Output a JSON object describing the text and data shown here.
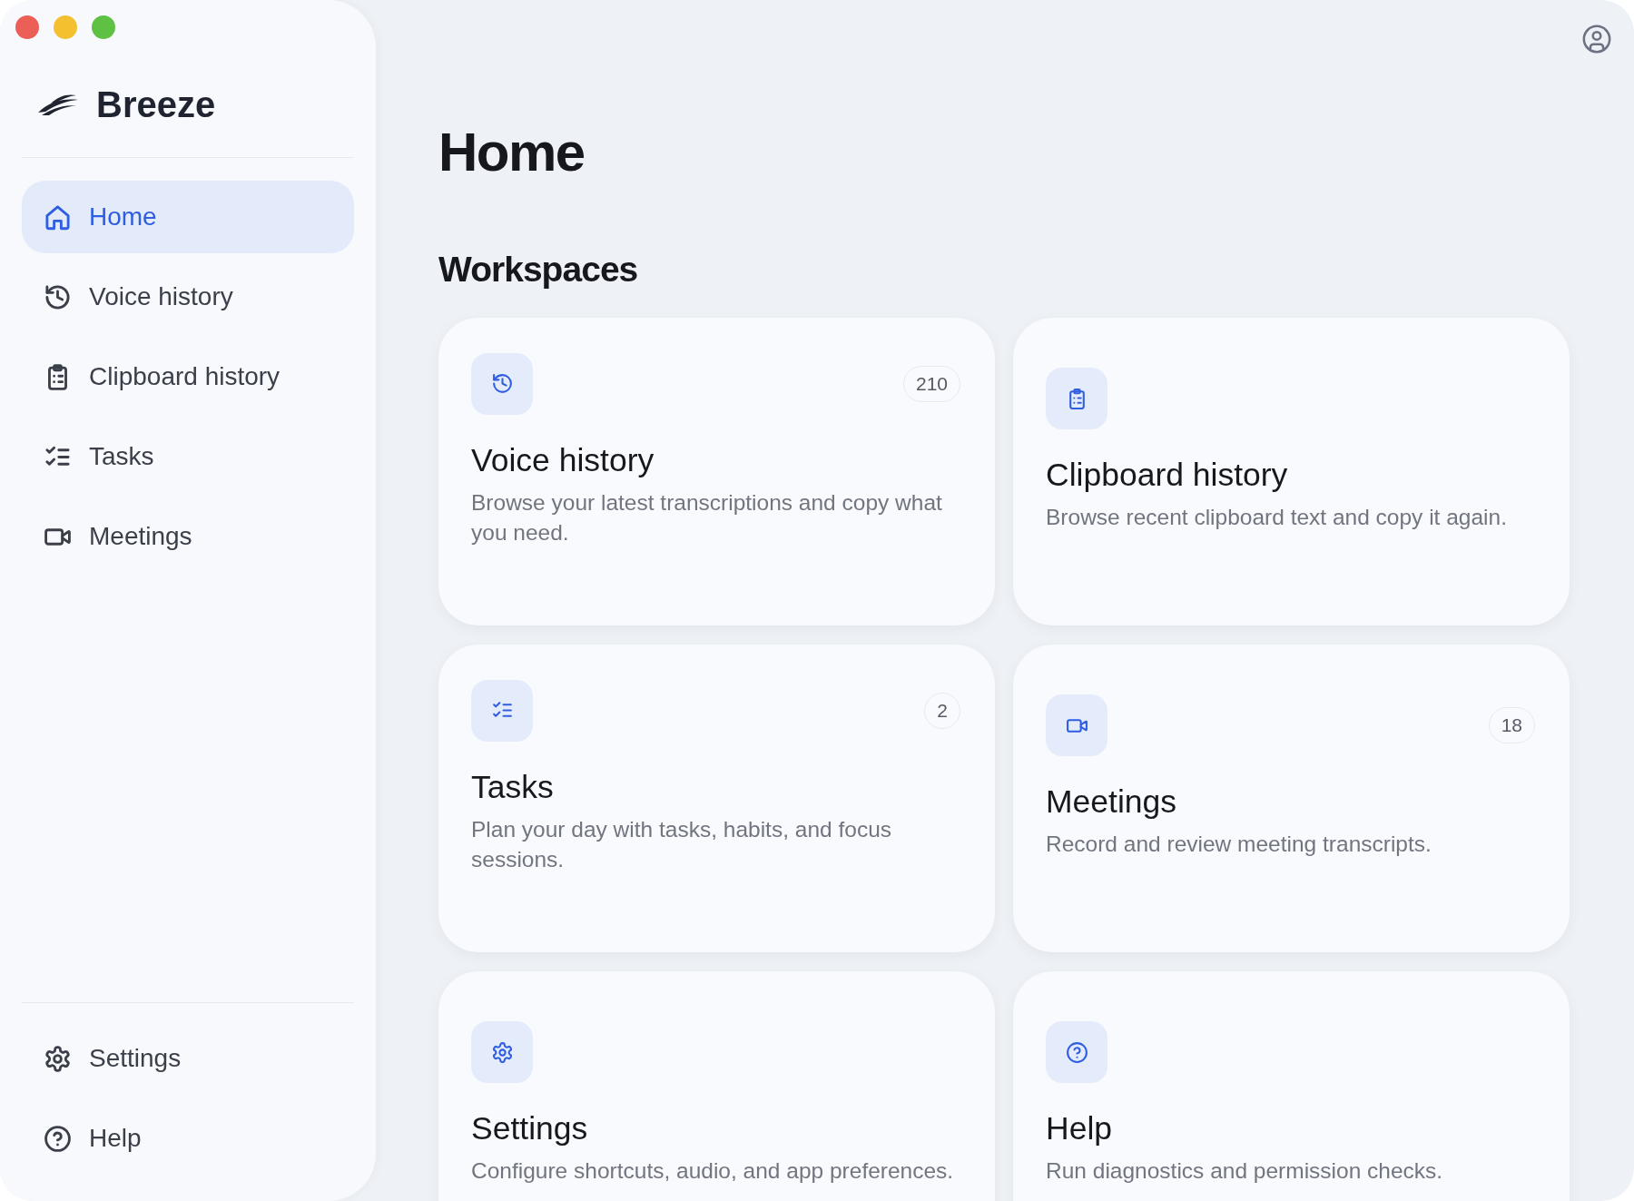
{
  "window": {
    "controls": [
      {
        "kind": "close"
      },
      {
        "kind": "minimize"
      },
      {
        "kind": "zoom"
      }
    ]
  },
  "sidebar": {
    "app_name": "Breeze",
    "items": [
      {
        "label": "Home",
        "kind": "home",
        "selected": true
      },
      {
        "label": "Voice history",
        "kind": "history",
        "selected": false
      },
      {
        "label": "Clipboard history",
        "kind": "clipboard",
        "selected": false
      },
      {
        "label": "Tasks",
        "kind": "tasks",
        "selected": false
      },
      {
        "label": "Meetings",
        "kind": "video",
        "selected": false
      }
    ],
    "footer_items": [
      {
        "label": "Settings",
        "kind": "gear",
        "selected": false
      },
      {
        "label": "Help",
        "kind": "help",
        "selected": false
      }
    ]
  },
  "main": {
    "title": "Home",
    "section_title": "Workspaces",
    "cards": [
      {
        "kind": "history",
        "title": "Voice history",
        "description": "Browse your latest transcriptions and copy what you need.",
        "count": "210"
      },
      {
        "kind": "clipboard",
        "title": "Clipboard history",
        "description": "Browse recent clipboard text and copy it again."
      },
      {
        "kind": "tasks",
        "title": "Tasks",
        "description": "Plan your day with tasks, habits, and focus sessions.",
        "count": "2"
      },
      {
        "kind": "video",
        "title": "Meetings",
        "description": "Record and review meeting transcripts.",
        "count": "18"
      },
      {
        "kind": "gear",
        "title": "Settings",
        "description": "Configure shortcuts, audio, and app preferences."
      },
      {
        "kind": "help",
        "title": "Help",
        "description": "Run diagnostics and permission checks."
      }
    ]
  }
}
